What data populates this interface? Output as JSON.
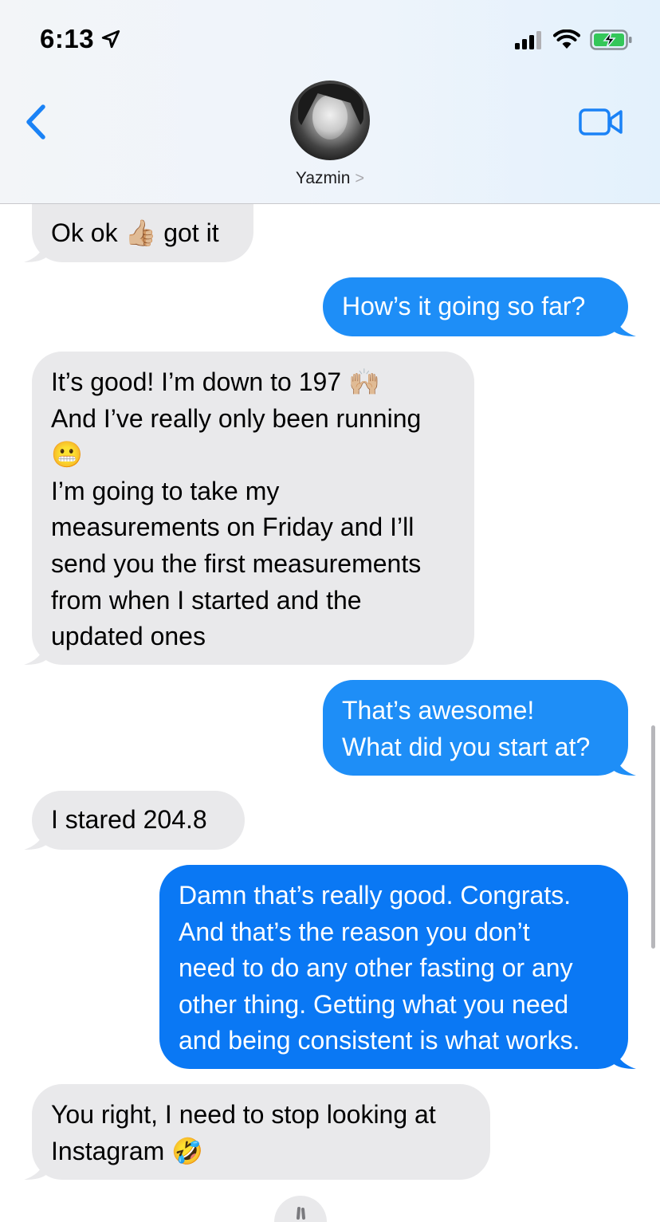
{
  "status_bar": {
    "time": "6:13"
  },
  "header": {
    "contact_name": "Yazmin",
    "chevron": ">"
  },
  "messages": [
    {
      "side": "in",
      "lines": [
        "Ok ok 👍🏼 got it"
      ]
    },
    {
      "side": "out",
      "lines": [
        "How’s it going so far?"
      ]
    },
    {
      "side": "in",
      "lines": [
        "It’s good! I’m down to 197 🙌🏼",
        "And I’ve really only been running",
        "😬",
        "I’m going to take my",
        "measurements on Friday and I’ll",
        "send you the first measurements",
        "from when I started and the",
        "updated ones"
      ]
    },
    {
      "side": "out",
      "lines": [
        "That’s awesome!",
        "What did you start at?"
      ]
    },
    {
      "side": "in",
      "lines": [
        "I stared 204.8"
      ]
    },
    {
      "side": "out",
      "lines": [
        "Damn that’s really good. Congrats.",
        "And that’s the reason you don’t",
        "need to do any other fasting or any",
        "other thing. Getting what you need",
        "and being consistent is what works."
      ]
    },
    {
      "side": "in",
      "lines": [
        "You right, I need to stop looking at",
        "Instagram 🤣"
      ]
    }
  ],
  "colors": {
    "incoming_bubble": "#e9e9eb",
    "outgoing_bubble": "#1e8ef7",
    "accent": "#1a82f6"
  },
  "icons": [
    "location-arrow-icon",
    "signal-icon",
    "wifi-icon",
    "battery-charging-icon",
    "back-chevron-icon",
    "video-camera-icon"
  ]
}
